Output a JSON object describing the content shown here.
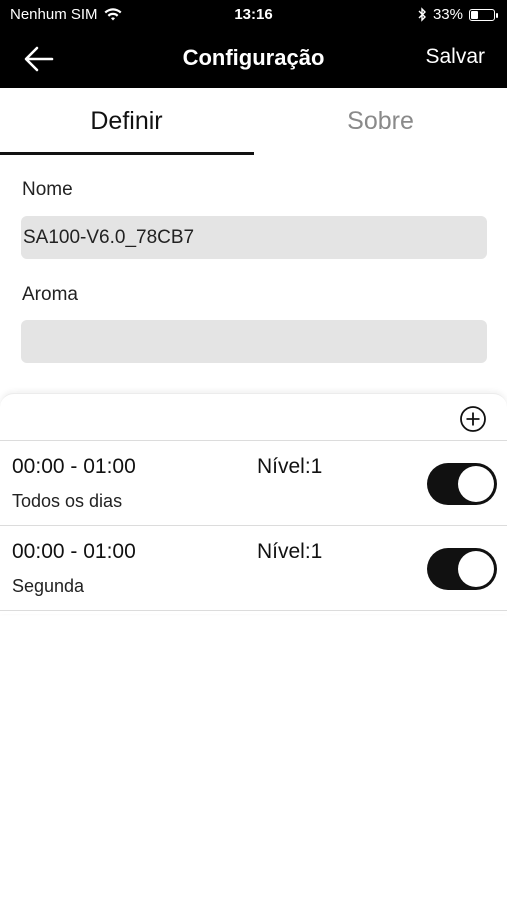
{
  "status_bar": {
    "carrier": "Nenhum SIM",
    "time": "13:16",
    "battery_percent": "33%",
    "battery_level": 0.33
  },
  "nav": {
    "back_icon": "arrow-left-icon",
    "title": "Configuração",
    "save_label": "Salvar"
  },
  "tabs": [
    {
      "label": "Definir",
      "active": true
    },
    {
      "label": "Sobre",
      "active": false
    }
  ],
  "form": {
    "name_label": "Nome",
    "name_value": "SA100-V6.0_78CB7",
    "aroma_label": "Aroma",
    "aroma_value": ""
  },
  "schedules": {
    "add_icon": "plus-circle-icon",
    "items": [
      {
        "time_range": "00:00 - 01:00",
        "level": "Nível:1",
        "days": "Todos os dias",
        "enabled": true
      },
      {
        "time_range": "00:00 - 01:00",
        "level": "Nível:1",
        "days": "Segunda",
        "enabled": true
      }
    ]
  },
  "colors": {
    "header_bg": "#000000",
    "input_bg": "#e4e4e4",
    "inactive_tab": "#8a8a8a",
    "toggle_on": "#111111"
  }
}
